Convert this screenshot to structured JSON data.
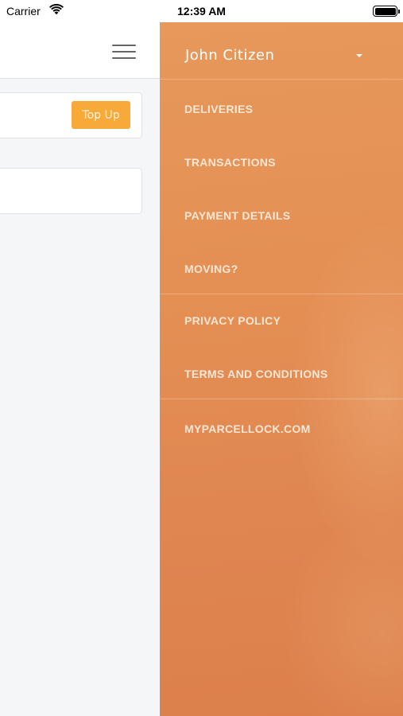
{
  "status_bar": {
    "carrier": "Carrier",
    "time": "12:39 AM",
    "wifi_icon": "wifi-icon",
    "battery_icon": "battery-icon"
  },
  "main": {
    "menu_icon": "hamburger-menu-icon",
    "balance_card": {
      "top_up_label": "Top Up"
    }
  },
  "side_menu": {
    "user_name": "John Citizen",
    "dropdown_icon": "caret-down-icon",
    "items": [
      {
        "label": "DELIVERIES"
      },
      {
        "label": "TRANSACTIONS"
      },
      {
        "label": "PAYMENT DETAILS"
      },
      {
        "label": "MOVING?"
      },
      {
        "label": "PRIVACY POLICY"
      },
      {
        "label": "TERMS AND CONDITIONS"
      },
      {
        "label": "MYPARCELLOCK.COM"
      }
    ]
  },
  "colors": {
    "accent": "#f7a93a",
    "menu_background": "#e48f54",
    "menu_text": "#fde6d4"
  }
}
